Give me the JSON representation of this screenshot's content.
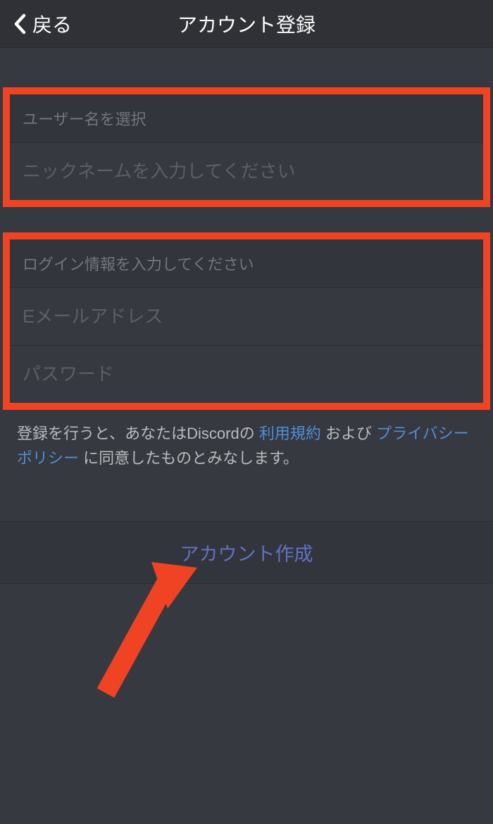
{
  "header": {
    "back_label": "戻る",
    "title": "アカウント登録"
  },
  "section1": {
    "header": "ユーザー名を選択",
    "nickname_placeholder": "ニックネームを入力してください"
  },
  "section2": {
    "header": "ログイン情報を入力してください",
    "email_placeholder": "Eメールアドレス",
    "password_placeholder": "パスワード"
  },
  "disclaimer": {
    "prefix": "登録を行うと、あなたはDiscordの ",
    "terms_link": "利用規約",
    "middle": " および ",
    "privacy_link": "プライバシーポリシー",
    "suffix": " に同意したものとみなします。"
  },
  "create_button_label": "アカウント作成"
}
